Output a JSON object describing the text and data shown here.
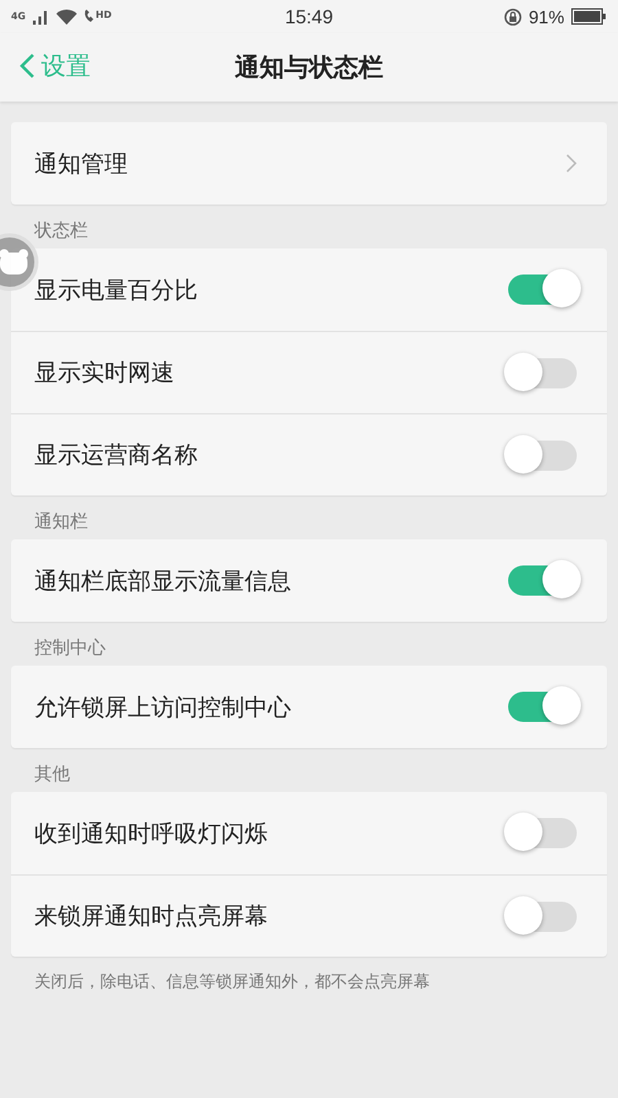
{
  "status_bar": {
    "network": "4G",
    "call": "HD",
    "time": "15:49",
    "battery_percent": "91%"
  },
  "nav": {
    "back_label": "设置",
    "title": "通知与状态栏"
  },
  "sections": [
    {
      "items": [
        {
          "kind": "link",
          "label": "通知管理"
        }
      ]
    },
    {
      "header": "状态栏",
      "items": [
        {
          "kind": "toggle",
          "label": "显示电量百分比",
          "on": true
        },
        {
          "kind": "toggle",
          "label": "显示实时网速",
          "on": false
        },
        {
          "kind": "toggle",
          "label": "显示运营商名称",
          "on": false
        }
      ]
    },
    {
      "header": "通知栏",
      "items": [
        {
          "kind": "toggle",
          "label": "通知栏底部显示流量信息",
          "on": true
        }
      ]
    },
    {
      "header": "控制中心",
      "items": [
        {
          "kind": "toggle",
          "label": "允许锁屏上访问控制中心",
          "on": true
        }
      ]
    },
    {
      "header": "其他",
      "items": [
        {
          "kind": "toggle",
          "label": "收到通知时呼吸灯闪烁",
          "on": false
        },
        {
          "kind": "toggle",
          "label": "来锁屏通知时点亮屏幕",
          "on": false
        }
      ],
      "footnote": "关闭后，除电话、信息等锁屏通知外，都不会点亮屏幕"
    }
  ]
}
